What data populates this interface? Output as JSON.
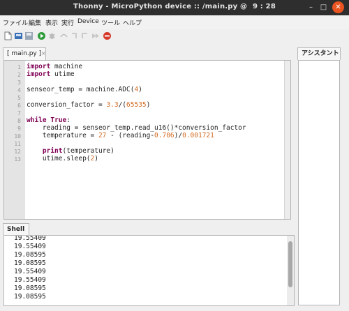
{
  "window": {
    "title": "Thonny - MicroPython device :: /main.py @",
    "clock": "9 : 28",
    "minimize_glyph": "–",
    "maximize_glyph": "□",
    "close_glyph": "✕"
  },
  "menu": [
    "ファイル",
    "編集",
    "表示",
    "実行",
    "Device",
    "ツール",
    "ヘルプ"
  ],
  "toolbar_icons": [
    "new-file-icon",
    "open-file-icon",
    "save-file-icon",
    "run-icon",
    "debug-icon",
    "step-over-icon",
    "step-into-icon",
    "step-out-icon",
    "resume-icon",
    "stop-icon"
  ],
  "editor": {
    "tab_label": "main.py",
    "tab_close": "×",
    "line_numbers": [
      "1",
      "2",
      "3",
      "4",
      "5",
      "6",
      "7",
      "8",
      "9",
      "10",
      "11",
      "12",
      "13"
    ]
  },
  "shell": {
    "tab_label": "Shell",
    "lines": [
      "19.55409",
      "19.55409",
      "19.08595",
      "19.08595",
      "19.55409",
      "19.55409",
      "19.08595",
      "19.08595"
    ]
  },
  "assistant": {
    "tab_label": "アシスタント"
  },
  "colors": {
    "keyword": "#7f0055",
    "number": "#d2691e",
    "close_button": "#e95420",
    "titlebar": "#2e2e2e"
  }
}
